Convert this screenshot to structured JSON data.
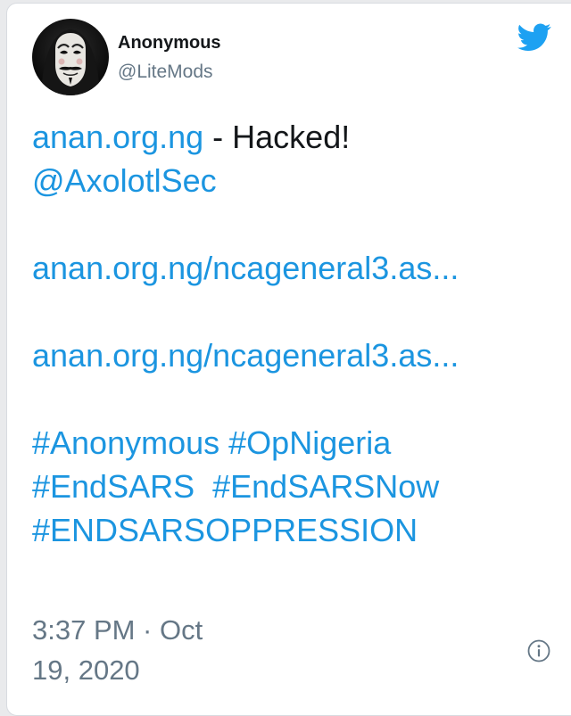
{
  "tweet": {
    "author": {
      "display_name": "Anonymous",
      "handle": "@LiteMods"
    },
    "text": {
      "line1_link": "anan.org.ng",
      "line1_text": " - Hacked!",
      "mention": "@AxolotlSec",
      "url1": "anan.org.ng/ncageneral3.as...",
      "url2": "anan.org.ng/ncageneral3.as...",
      "hashtags_line1": [
        {
          "text": "#Anonymous"
        },
        {
          "text": "#OpNigeria"
        }
      ],
      "hashtags_line2": [
        {
          "text": "#EndSARS"
        },
        {
          "text": "#EndSARSNow"
        }
      ],
      "hashtags_line3": [
        {
          "text": "#ENDSARSOPPRESSION"
        }
      ]
    },
    "timestamp": {
      "line1": "3:37 PM · Oct",
      "line2": "19, 2020"
    }
  },
  "icons": {
    "platform_logo": "twitter-bird-icon",
    "info": "info-icon",
    "avatar": "guy-fawkes-mask-avatar"
  },
  "colors": {
    "link": "#1b95e0",
    "text": "#14171a",
    "secondary": "#657786",
    "twitter_blue": "#1da1f2"
  }
}
